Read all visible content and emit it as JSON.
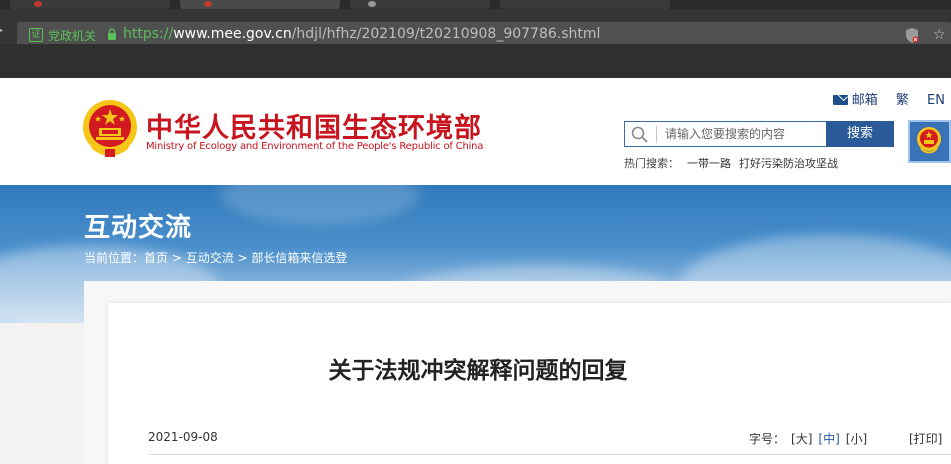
{
  "browser": {
    "address": {
      "cert_label": "证",
      "site_tag": "党政机关",
      "url_protocol": "https://",
      "url_host": "www.mee.gov.cn",
      "url_path": "/hdjl/hfhz/202109/t20210908_907786.shtml"
    }
  },
  "header": {
    "title_cn": "中华人民共和国生态环境部",
    "title_en": "Ministry of Ecology and Environment of the People's Republic of China",
    "links": {
      "mail": "邮箱",
      "traditional": "繁",
      "english": "EN"
    },
    "search": {
      "placeholder": "请输入您要搜索的内容",
      "button": "搜索"
    },
    "hot_search": {
      "label": "热门搜索：",
      "items": [
        "一带一路",
        "打好污染防治攻坚战"
      ]
    }
  },
  "banner": {
    "section_title": "互动交流",
    "breadcrumb": {
      "prefix": "当前位置：",
      "items": [
        "首页",
        "互动交流",
        "部长信箱来信选登"
      ],
      "separator": " > "
    }
  },
  "article": {
    "title": "关于法规冲突解释问题的回复",
    "date": "2021-09-08",
    "font_size": {
      "label": "字号：",
      "options": [
        "[大]",
        "[中]",
        "[小]"
      ],
      "active": "[中]"
    },
    "print": "[打印]"
  },
  "colors": {
    "brand_red": "#c8141e",
    "brand_blue": "#2a5a98",
    "secure_green": "#5bbf5b"
  }
}
